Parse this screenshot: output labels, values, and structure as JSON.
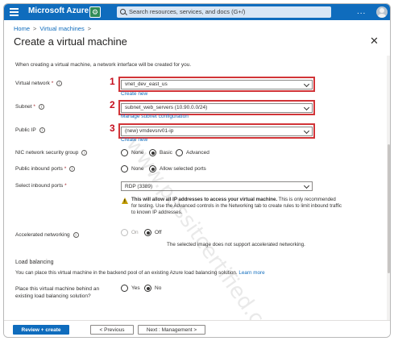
{
  "topbar": {
    "brand": "Microsoft Azure",
    "cloudshell_badge": "⚙",
    "search_placeholder": "Search resources, services, and docs (G+/)",
    "more": "..."
  },
  "breadcrumb": [
    "Home",
    "Virtual machines"
  ],
  "breadcrumb_sep": ">",
  "page_title": "Create a virtual machine",
  "close_glyph": "✕",
  "intro": "When creating a virtual machine, a network interface will be created for you.",
  "fields": {
    "virtual_network": {
      "label": "Virtual network",
      "required": "*",
      "value": "vnet_dev_east_us",
      "link": "Create new",
      "marker": "1"
    },
    "subnet": {
      "label": "Subnet",
      "required": "*",
      "value": "subnet_web_servers (10.90.0.0/24)",
      "link": "Manage subnet configuration",
      "marker": "2"
    },
    "public_ip": {
      "label": "Public IP",
      "value": "(new) vmdevsrv01-ip",
      "link": "Create new",
      "marker": "3"
    },
    "nsg": {
      "label": "NIC network security group",
      "options": [
        "None",
        "Basic",
        "Advanced"
      ],
      "selected": "Basic"
    },
    "inbound_ports": {
      "label": "Public inbound ports",
      "required": "*",
      "options": [
        "None",
        "Allow selected ports"
      ],
      "selected": "Allow selected ports"
    },
    "select_ports": {
      "label": "Select inbound ports",
      "required": "*",
      "value": "RDP (3389)"
    },
    "accel": {
      "label": "Accelerated networking",
      "options": [
        "On",
        "Off"
      ],
      "selected": "Off",
      "note": "The selected image does not support accelerated networking."
    },
    "lb_question": {
      "label_line1": "Place this virtual machine behind an",
      "label_line2": "existing load balancing solution?",
      "options": [
        "Yes",
        "No"
      ],
      "selected": "No"
    }
  },
  "info_glyph": "i",
  "warning": {
    "icon_glyph": "!",
    "bold": "This will allow all IP addresses to access your virtual machine.",
    "text": " This is only recommended for testing.  Use the Advanced controls in the Networking tab to create rules to limit inbound traffic to known IP addresses."
  },
  "load_balancing": {
    "heading": "Load balancing",
    "description": "You can place this virtual machine in the backend pool of an existing Azure load balancing solution.",
    "learn_more": "Learn more"
  },
  "footer": {
    "review": "Review + create",
    "previous": "< Previous",
    "next": "Next : Management >"
  },
  "watermark": "www.passitcertified.com",
  "colors": {
    "accent": "#0f6cbd",
    "highlight": "#d13438",
    "warning": "#c19c00"
  }
}
